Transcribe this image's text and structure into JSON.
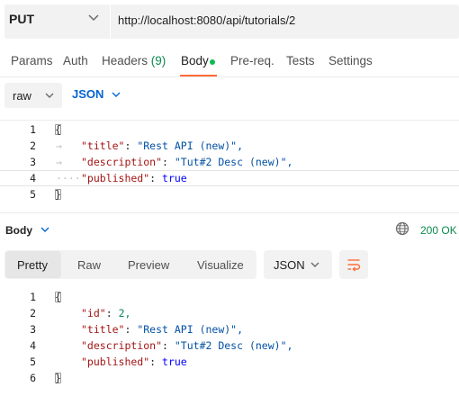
{
  "request": {
    "method": "PUT",
    "url": "http://localhost:8080/api/tutorials/2",
    "tabs": [
      {
        "label": "Params"
      },
      {
        "label": "Auth"
      },
      {
        "label": "Headers",
        "count": "(9)"
      },
      {
        "label": "Body",
        "active": true
      },
      {
        "label": "Pre-req."
      },
      {
        "label": "Tests"
      },
      {
        "label": "Settings"
      }
    ],
    "body_mode": "raw",
    "body_language": "JSON",
    "body_lines": [
      {
        "num": "1",
        "text": "{"
      },
      {
        "num": "2",
        "key": "\"title\"",
        "value": "\"Rest API (new)\","
      },
      {
        "num": "3",
        "key": "\"description\"",
        "value": "\"Tut#2 Desc (new)\","
      },
      {
        "num": "4",
        "key": "\"published\"",
        "value": "true"
      },
      {
        "num": "5",
        "text": "}"
      }
    ]
  },
  "response": {
    "label": "Body",
    "status": "200 OK",
    "view_tabs": [
      {
        "label": "Pretty",
        "active": true
      },
      {
        "label": "Raw"
      },
      {
        "label": "Preview"
      },
      {
        "label": "Visualize"
      }
    ],
    "format": "JSON",
    "lines": [
      {
        "num": "1",
        "text": "{"
      },
      {
        "num": "2",
        "key": "\"id\"",
        "value": "2,"
      },
      {
        "num": "3",
        "key": "\"title\"",
        "value": "\"Rest API (new)\","
      },
      {
        "num": "4",
        "key": "\"description\"",
        "value": "\"Tut#2 Desc (new)\","
      },
      {
        "num": "5",
        "key": "\"published\"",
        "value": "true"
      },
      {
        "num": "6",
        "text": "}"
      }
    ]
  },
  "colors": {
    "accent_orange": "#ff6c37",
    "status_green": "#0d8a4e",
    "link_blue": "#0265d2",
    "json_key": "#a31515",
    "json_string": "#0451a5",
    "json_bool": "#0000ff"
  },
  "icons": [
    "chevron-down-icon",
    "globe-icon",
    "wrap-lines-icon"
  ]
}
